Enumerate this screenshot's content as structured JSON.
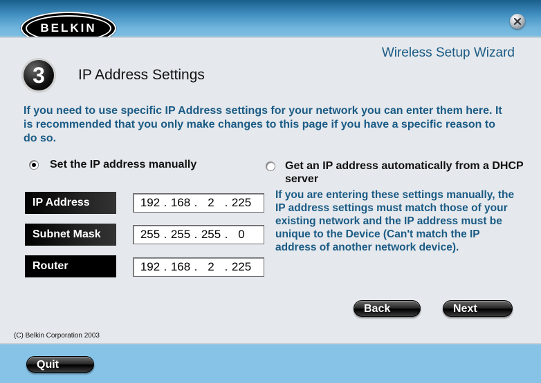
{
  "brand": {
    "logo_text": "BELKIN"
  },
  "window": {
    "close_icon": "close-icon"
  },
  "wizard": {
    "title": "Wireless Setup Wizard",
    "step_number": "3",
    "page_title": "IP Address Settings"
  },
  "description": "If you need to use specific IP Address settings for your network you can enter them here. It is recommended that you only make changes to this page if you have a specific reason to do so.",
  "options": {
    "manual": {
      "label": "Set the IP address manually",
      "selected": true
    },
    "auto": {
      "label": "Get an IP address automatically from a DHCP server",
      "selected": false
    }
  },
  "fields": {
    "ip_address": {
      "label": "IP Address",
      "octets": [
        "192",
        "168",
        "2",
        "225"
      ]
    },
    "subnet_mask": {
      "label": "Subnet Mask",
      "octets": [
        "255",
        "255",
        "255",
        "0"
      ]
    },
    "router": {
      "label": "Router",
      "octets": [
        "192",
        "168",
        "2",
        "225"
      ]
    }
  },
  "help_text": "If you are entering these settings manually, the IP address settings must match those of your existing network and the IP address must be unique to the Device (Can't match the IP address of another network device).",
  "buttons": {
    "back": "Back",
    "next": "Next",
    "quit": "Quit"
  },
  "footer": {
    "copyright": "(C) Belkin Corporation 2003"
  },
  "colors": {
    "accent_text": "#1a5b85",
    "panel": "#e5e8ec",
    "frame": "#86c3e6"
  }
}
